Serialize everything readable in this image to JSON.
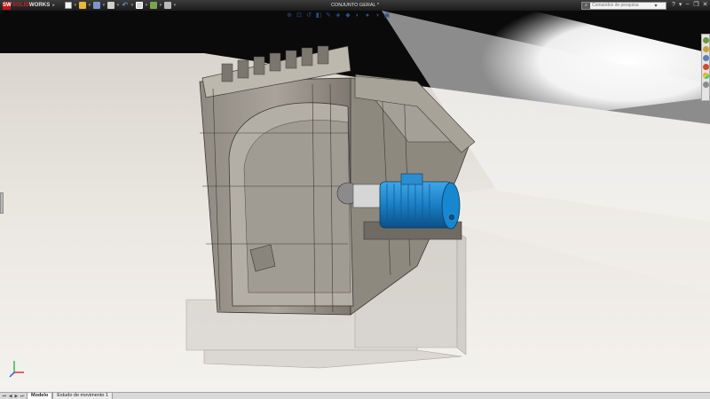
{
  "app": {
    "logo_mark": "SW",
    "logo_prefix": "SOLID",
    "logo_suffix": "WORKS",
    "menu_arrow": "▸",
    "document_title": "CONJUNTO GERAL *"
  },
  "quick_access": [
    {
      "name": "new-document-button",
      "cls": "new"
    },
    {
      "name": "open-document-button",
      "cls": "open"
    },
    {
      "name": "save-button",
      "cls": "save"
    },
    {
      "name": "print-button",
      "cls": "print"
    },
    {
      "name": "undo-button",
      "cls": "undo"
    },
    {
      "name": "select-button",
      "cls": "select"
    },
    {
      "name": "rebuild-button",
      "cls": "rebuild"
    },
    {
      "name": "options-button",
      "cls": "options"
    }
  ],
  "search": {
    "placeholder": "Comandos de pesquisa",
    "icon": "search-icon"
  },
  "window_controls": {
    "minimize": "−",
    "restore": "❐",
    "close": "✕"
  },
  "view_toolbar": [
    "zoom-to-fit-icon",
    "zoom-area-icon",
    "previous-view-icon",
    "section-view-icon",
    "dynamic-annotation-icon",
    "view-orientation-icon",
    "display-style-icon",
    "hide-show-icon",
    "edit-appearance-icon",
    "apply-scene-icon",
    "view-settings-icon"
  ],
  "task_pane": [
    {
      "name": "solidworks-resources-icon",
      "cls": "home"
    },
    {
      "name": "design-library-icon",
      "cls": "lib"
    },
    {
      "name": "file-explorer-icon",
      "cls": "explorer"
    },
    {
      "name": "search-results-icon",
      "cls": "search2"
    },
    {
      "name": "appearances-scenes-icon",
      "cls": "palette"
    },
    {
      "name": "custom-properties-icon",
      "cls": "custom"
    }
  ],
  "colors": {
    "motor_blue": "#1a7fc4",
    "steel": "#9d9890",
    "background_light": "#efece6",
    "titlebar_dark": "#242424"
  },
  "tabs": [
    {
      "label": "Modelo",
      "active": true
    },
    {
      "label": "Estudo de movimento 1",
      "active": false
    }
  ]
}
